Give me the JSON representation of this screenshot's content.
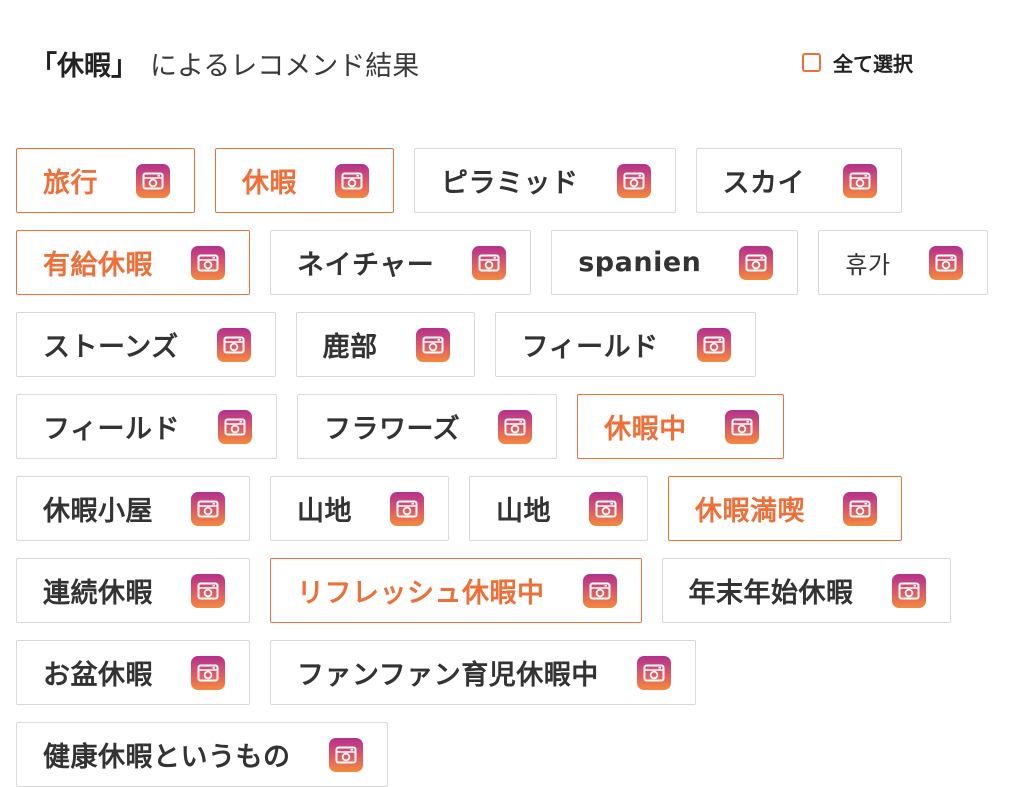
{
  "header": {
    "keyword": "「休暇」",
    "title_suffix": "によるレコメンド結果",
    "select_all_label": "全て選択"
  },
  "tags": [
    {
      "label": "旅行",
      "selected": true
    },
    {
      "label": "休暇",
      "selected": true
    },
    {
      "label": "ピラミッド",
      "selected": false
    },
    {
      "label": "スカイ",
      "selected": false
    },
    {
      "label": "有給休暇",
      "selected": true
    },
    {
      "label": "ネイチャー",
      "selected": false
    },
    {
      "label": "spanien",
      "selected": false
    },
    {
      "label": "휴가",
      "selected": false
    },
    {
      "label": "ストーンズ",
      "selected": false
    },
    {
      "label": "鹿部",
      "selected": false
    },
    {
      "label": "フィールド",
      "selected": false
    },
    {
      "label": "フィールド",
      "selected": false
    },
    {
      "label": "フラワーズ",
      "selected": false
    },
    {
      "label": "休暇中",
      "selected": true
    },
    {
      "label": "休暇小屋",
      "selected": false
    },
    {
      "label": "山地",
      "selected": false
    },
    {
      "label": "山地",
      "selected": false
    },
    {
      "label": "休暇満喫",
      "selected": true
    },
    {
      "label": "連続休暇",
      "selected": false
    },
    {
      "label": "リフレッシュ休暇中",
      "selected": true
    },
    {
      "label": "年末年始休暇",
      "selected": false
    },
    {
      "label": "お盆休暇",
      "selected": false
    },
    {
      "label": "ファンファン育児休暇中",
      "selected": false
    },
    {
      "label": "健康休暇というもの",
      "selected": false
    }
  ],
  "icons": {
    "tag_icon": "instagram-camera-icon",
    "checkbox": "checkbox-unchecked-icon"
  },
  "colors": {
    "accent": "#ef6f39",
    "text": "#333333",
    "border": "#d9d9d9",
    "icon_gradient_top": "#b3308f",
    "icon_gradient_bottom": "#f38a3c"
  }
}
